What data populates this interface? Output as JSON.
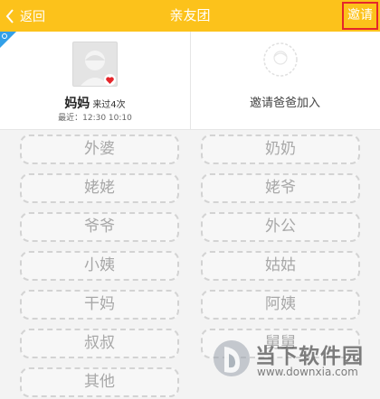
{
  "header": {
    "back_label": "返回",
    "title": "亲友团",
    "invite_label": "邀请"
  },
  "member": {
    "name": "妈妈",
    "visits": "来过4次",
    "last_visit": "最近：12:30 10:10"
  },
  "invite_slot": {
    "label": "邀请爸爸加入"
  },
  "relations": {
    "left": [
      "外婆",
      "姥姥",
      "爷爷",
      "小姨",
      "干妈",
      "叔叔",
      "其他"
    ],
    "right": [
      "奶奶",
      "姥爷",
      "外公",
      "姑姑",
      "阿姨",
      "舅舅"
    ]
  },
  "watermark": {
    "title": "当下软件园",
    "url": "www.downxia.com"
  },
  "colors": {
    "header": "#fcc21b",
    "invite_border": "#e5262b",
    "corner_tag": "#33a0e8",
    "heart": "#e5262b"
  }
}
